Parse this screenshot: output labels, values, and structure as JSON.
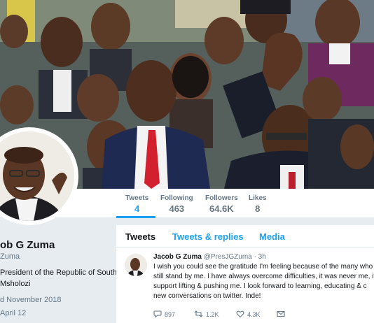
{
  "colors": {
    "accent": "#1da1f2",
    "text": "#14171a",
    "muted": "#657786",
    "background": "#e6ecf0"
  },
  "stats": [
    {
      "label": "Tweets",
      "value": "4",
      "active": true
    },
    {
      "label": "Following",
      "value": "463"
    },
    {
      "label": "Followers",
      "value": "64.6K"
    },
    {
      "label": "Likes",
      "value": "8"
    }
  ],
  "profile": {
    "name": "ob G Zuma",
    "handle": "Zuma",
    "bio_line1": "President of the Republic of South",
    "bio_line2": "Msholozi",
    "joined": "d November 2018",
    "birthday": "April 12",
    "joined_icon": "calendar-icon",
    "birthday_icon": "balloon-icon"
  },
  "timeline": {
    "tabs": [
      {
        "label": "Tweets",
        "active": true
      },
      {
        "label": "Tweets & replies"
      },
      {
        "label": "Media"
      }
    ]
  },
  "tweet": {
    "name": "Jacob G Zuma",
    "handle": "@PresJGZuma",
    "dot": "·",
    "time": "3h",
    "lines": [
      "I wish you could see the gratitude I'm feeling because of the many who",
      "still stand by me. I have always overcome difficulties, it was never me, it",
      "support lifting & pushing me. I look forward to learning, educating & c",
      "new conversations on twitter. Inde!"
    ],
    "actions": {
      "replies": "897",
      "retweets": "1.2K",
      "likes": "4.3K",
      "reply_icon": "reply-icon",
      "retweet_icon": "retweet-icon",
      "like_icon": "heart-icon",
      "dm_icon": "envelope-icon"
    }
  }
}
